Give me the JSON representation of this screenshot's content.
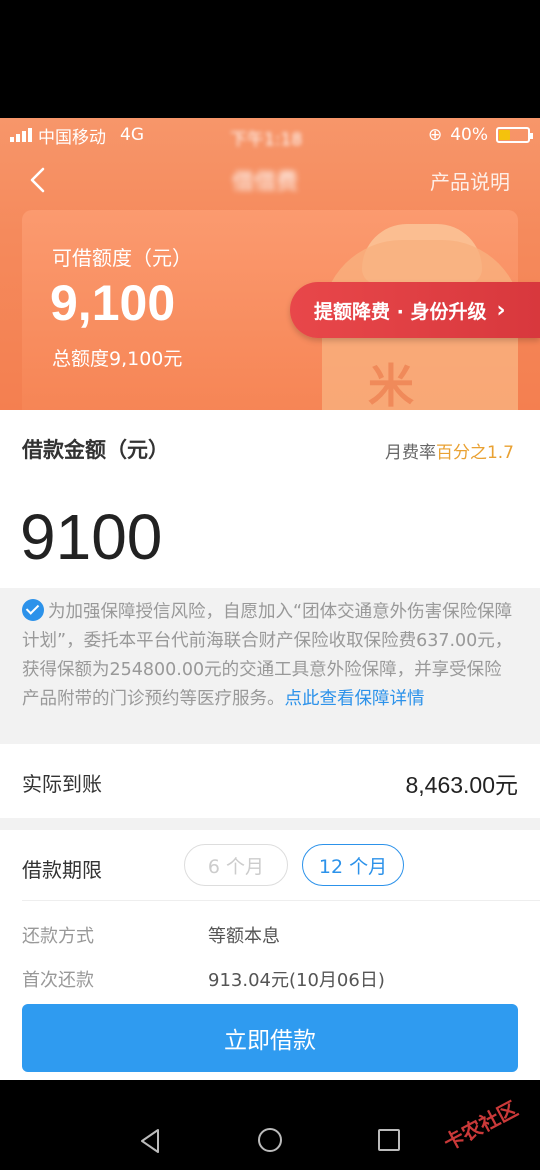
{
  "status": {
    "carrier": "中国移动",
    "network": "4G",
    "time": "下午1:18",
    "battery": "40%",
    "battery_level": 0.4
  },
  "nav": {
    "title": "借借费",
    "right": "产品说明"
  },
  "card": {
    "label": "可借额度（元）",
    "amount": "9,100",
    "total": "总额度9,100元",
    "bag_mark": "米",
    "upgrade": "提额降费 · 身份升级",
    "upgrade_chevron": "›"
  },
  "loan": {
    "heading": "借款金额（元）",
    "rate_prefix": "月费率",
    "rate_value": "百分之1.7",
    "amount": "9100"
  },
  "insurance": {
    "text": "为加强保障授信风险，自愿加入“团体交通意外伤害保险保障计划”，委托本平台代前海联合财产保险收取保险费637.00元，获得保额为254800.00元的交通工具意外险保障，并享受保险产品附带的门诊预约等医疗服务。",
    "link": "点此查看保障详情"
  },
  "arrival": {
    "label": "实际到账",
    "value": "8,463.00元"
  },
  "term": {
    "label": "借款期限",
    "options": [
      "6 个月",
      "12 个月"
    ],
    "selected": "12 个月"
  },
  "repay": {
    "method_label": "还款方式",
    "method_value": "等额本息",
    "first_label": "首次还款",
    "first_value": "913.04元(10月06日)"
  },
  "cta": {
    "label": "立即借款"
  },
  "watermark": "卡农社区",
  "colors": {
    "accent": "#2f9bf0",
    "hero": "#f58a5c",
    "pill": "#e8474a",
    "rate_highlight": "#e9a132"
  }
}
